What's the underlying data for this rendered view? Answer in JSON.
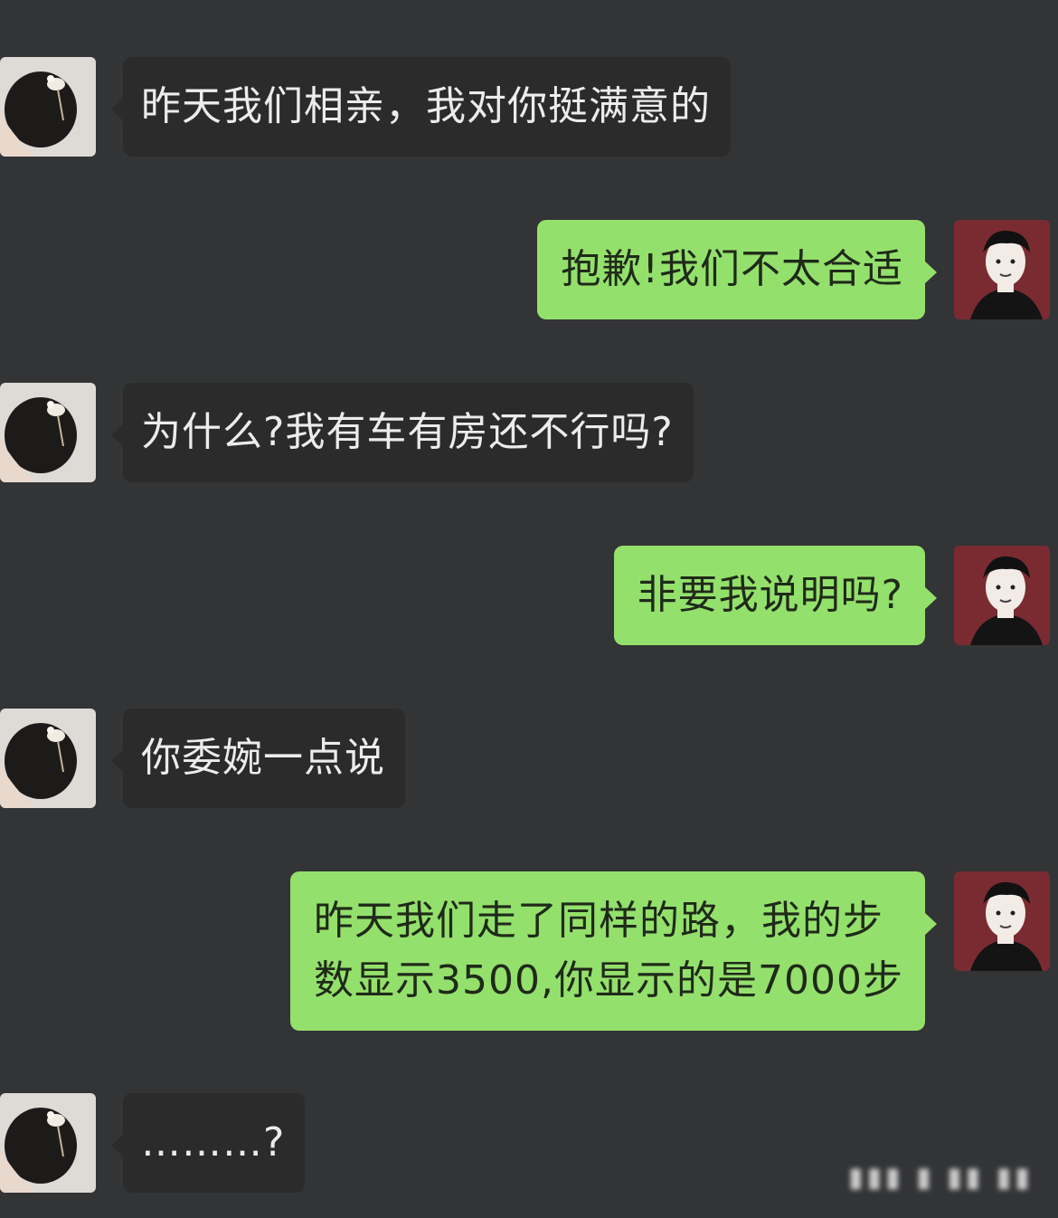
{
  "app": {
    "name": "chat-conversation"
  },
  "messages": [
    {
      "side": "left",
      "avatar": "female-avatar",
      "text": "昨天我们相亲，我对你挺满意的"
    },
    {
      "side": "right",
      "avatar": "male-avatar",
      "text": "抱歉!我们不太合适"
    },
    {
      "side": "left",
      "avatar": "female-avatar",
      "text": "为什么?我有车有房还不行吗?"
    },
    {
      "side": "right",
      "avatar": "male-avatar",
      "text": "非要我说明吗?"
    },
    {
      "side": "left",
      "avatar": "female-avatar",
      "text": "你委婉一点说"
    },
    {
      "side": "right",
      "avatar": "male-avatar",
      "lines": [
        "昨天我们走了同样的路，我的步",
        "数显示3500,你显示的是7000步"
      ]
    },
    {
      "side": "left",
      "avatar": "female-avatar",
      "text": "………?"
    }
  ],
  "colors": {
    "background": "#333436",
    "incoming_bubble": "#2b2b2b",
    "outgoing_bubble": "#94e06c",
    "male_avatar_bg": "#7a2b32"
  },
  "icons": {
    "female_avatar": "female-avatar-icon",
    "male_avatar": "male-avatar-icon"
  }
}
